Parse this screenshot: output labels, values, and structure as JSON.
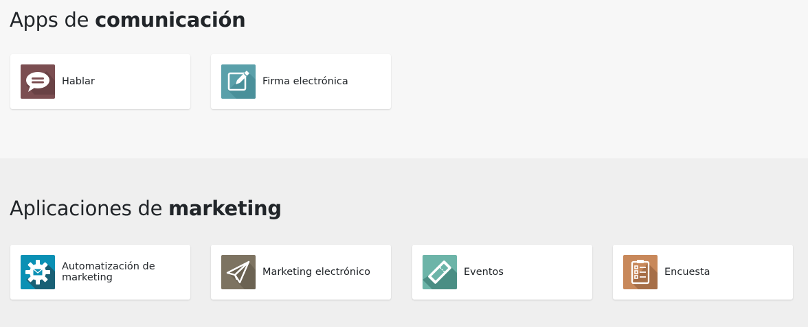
{
  "communication": {
    "title_prefix": "Apps de ",
    "title_bold": "comunicación",
    "apps": [
      {
        "label": "Hablar",
        "icon": "chat-bubble-icon",
        "color": "#7b4e51"
      },
      {
        "label": "Firma electrónica",
        "icon": "signature-pen-icon",
        "color": "#5aa0aa"
      }
    ]
  },
  "marketing": {
    "title_prefix": "Aplicaciones de ",
    "title_bold": "marketing",
    "apps": [
      {
        "label": "Automatización de marketing",
        "icon": "gear-envelope-icon",
        "color": "#0a90b4"
      },
      {
        "label": "Marketing electrónico",
        "icon": "paper-plane-icon",
        "color": "#7d7361"
      },
      {
        "label": "Eventos",
        "icon": "ticket-icon",
        "color": "#6cb4a8"
      },
      {
        "label": "Encuesta",
        "icon": "clipboard-checklist-icon",
        "color": "#c8885a"
      }
    ]
  }
}
